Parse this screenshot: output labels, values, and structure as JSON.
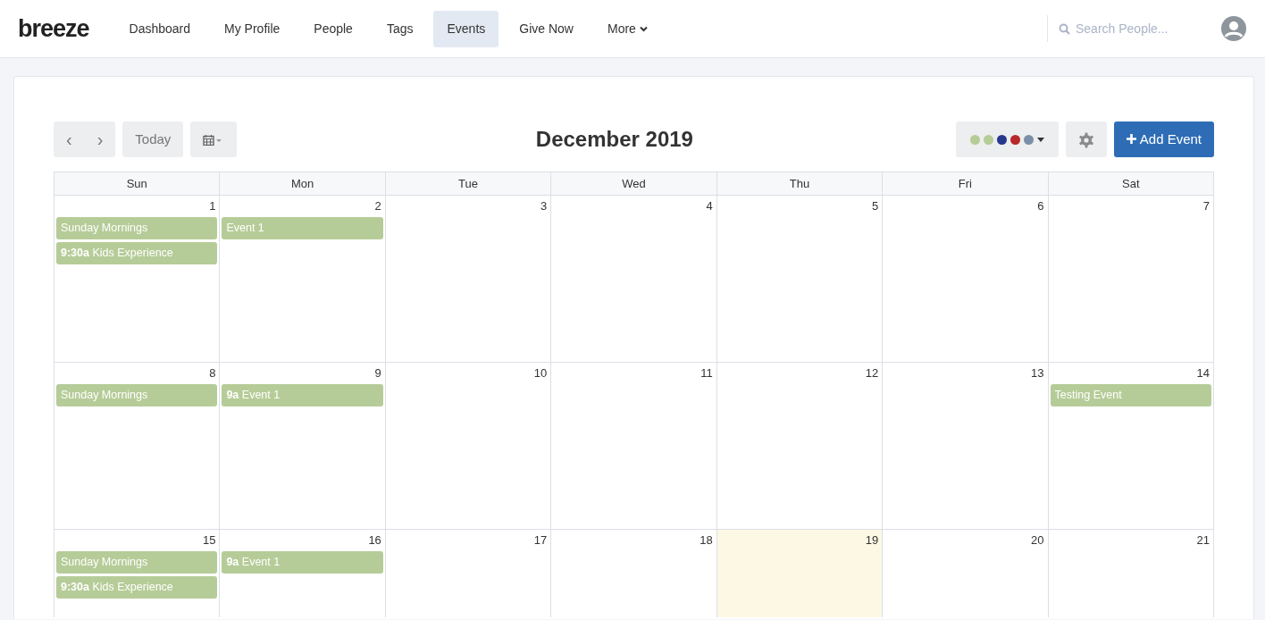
{
  "brand": "breeze",
  "nav": [
    {
      "label": "Dashboard",
      "selected": false
    },
    {
      "label": "My Profile",
      "selected": false
    },
    {
      "label": "People",
      "selected": false
    },
    {
      "label": "Tags",
      "selected": false
    },
    {
      "label": "Events",
      "selected": true
    },
    {
      "label": "Give Now",
      "selected": false
    },
    {
      "label": "More",
      "selected": false,
      "kind": "dropdown"
    }
  ],
  "search": {
    "placeholder": "Search People..."
  },
  "toolbar": {
    "prev": "‹",
    "next": "›",
    "today": "Today",
    "title": "December 2019",
    "add": "Add Event",
    "filter_dots": [
      {
        "color": "#b5cc96"
      },
      {
        "color": "#b5cc96"
      },
      {
        "color": "#25388c"
      },
      {
        "color": "#b8282a"
      },
      {
        "color": "#7b90a8"
      }
    ]
  },
  "weekdays": [
    "Sun",
    "Mon",
    "Tue",
    "Wed",
    "Thu",
    "Fri",
    "Sat"
  ],
  "weeks": [
    [
      {
        "day": "1",
        "today": false,
        "events": [
          {
            "title": "Sunday Mornings",
            "color": "#b6cc98"
          },
          {
            "time": "9:30a",
            "title": "Kids Experience",
            "color": "#b6cc98"
          }
        ]
      },
      {
        "day": "2",
        "today": false,
        "events": [
          {
            "title": "Event 1",
            "color": "#b6cc98"
          }
        ]
      },
      {
        "day": "3",
        "today": false
      },
      {
        "day": "4",
        "today": false
      },
      {
        "day": "5",
        "today": false
      },
      {
        "day": "6",
        "today": false
      },
      {
        "day": "7",
        "today": false
      }
    ],
    [
      {
        "day": "8",
        "today": false,
        "events": [
          {
            "title": "Sunday Mornings",
            "color": "#b6cc98"
          }
        ]
      },
      {
        "day": "9",
        "today": false,
        "events": [
          {
            "time": "9a",
            "title": "Event 1",
            "color": "#b6cc98"
          }
        ]
      },
      {
        "day": "10",
        "today": false
      },
      {
        "day": "11",
        "today": false
      },
      {
        "day": "12",
        "today": false
      },
      {
        "day": "13",
        "today": false
      },
      {
        "day": "14",
        "today": false,
        "events": [
          {
            "title": "Testing Event",
            "color": "#b6cc98"
          }
        ]
      }
    ],
    [
      {
        "day": "15",
        "today": false,
        "events": [
          {
            "title": "Sunday Mornings",
            "color": "#b6cc98"
          },
          {
            "time": "9:30a",
            "title": "Kids Experience",
            "color": "#b6cc98"
          }
        ]
      },
      {
        "day": "16",
        "today": false,
        "events": [
          {
            "time": "9a",
            "title": "Event 1",
            "color": "#b6cc98"
          }
        ]
      },
      {
        "day": "17",
        "today": false
      },
      {
        "day": "18",
        "today": false
      },
      {
        "day": "19",
        "today": true
      },
      {
        "day": "20",
        "today": false
      },
      {
        "day": "21",
        "today": false
      }
    ]
  ]
}
